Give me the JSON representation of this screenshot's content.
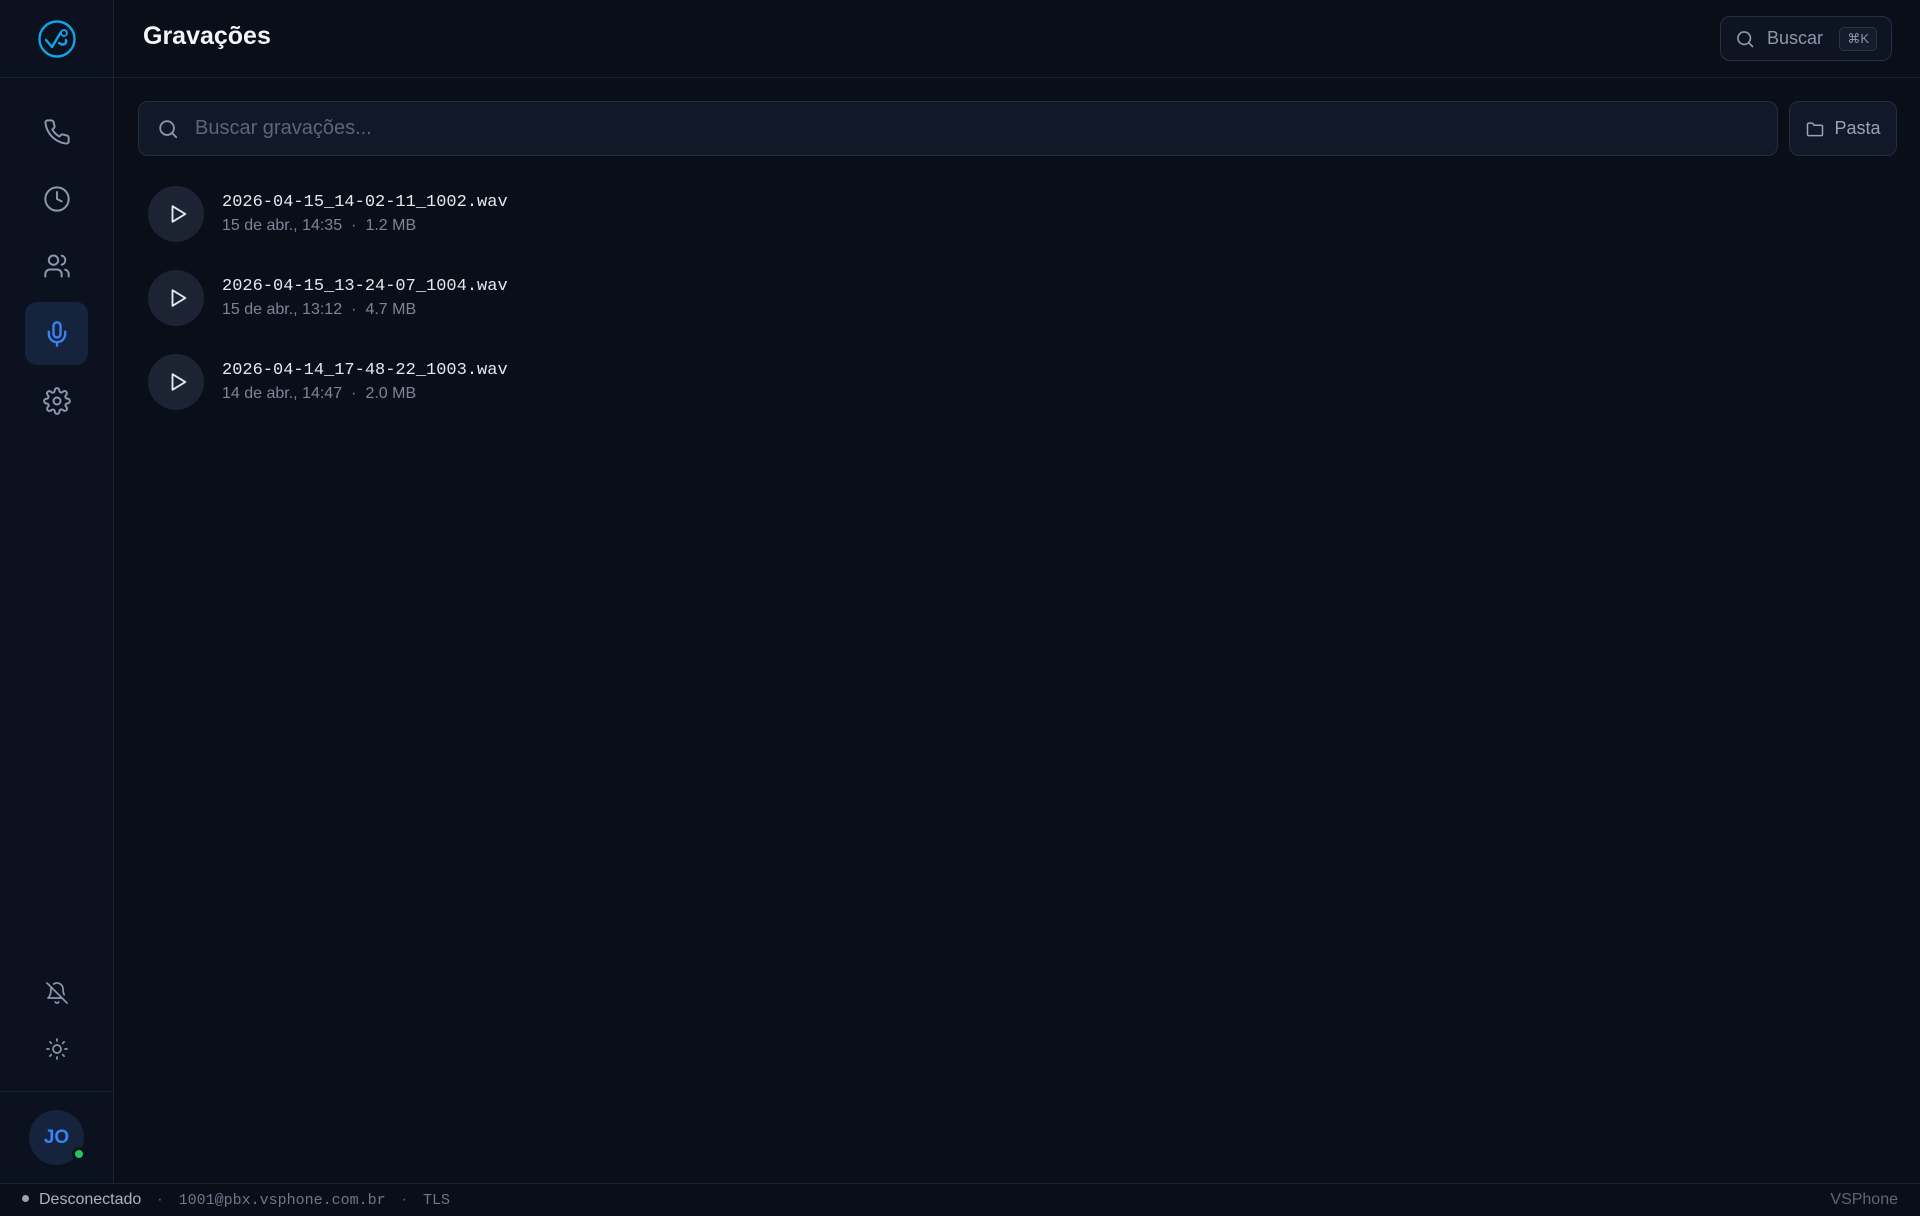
{
  "app": {
    "brand": "VSPhone"
  },
  "header": {
    "title": "Gravações",
    "search_label": "Buscar",
    "search_shortcut": "⌘K"
  },
  "sidebar": {
    "nav": [
      {
        "name": "phone",
        "icon": "phone-icon",
        "active": false
      },
      {
        "name": "history",
        "icon": "clock-icon",
        "active": false
      },
      {
        "name": "contacts",
        "icon": "users-icon",
        "active": false
      },
      {
        "name": "recordings",
        "icon": "microphone-icon",
        "active": true
      },
      {
        "name": "settings",
        "icon": "gear-icon",
        "active": false
      }
    ],
    "utilities": [
      {
        "name": "notifications",
        "icon": "bell-off-icon"
      },
      {
        "name": "theme",
        "icon": "sun-icon"
      }
    ],
    "user": {
      "initials": "JO",
      "presence": "online"
    }
  },
  "main": {
    "search_placeholder": "Buscar gravações...",
    "folder_label": "Pasta",
    "recordings": [
      {
        "filename": "2026-04-15_14-02-11_1002.wav",
        "date": "15 de abr., 14:35",
        "size": "1.2 MB"
      },
      {
        "filename": "2026-04-15_13-24-07_1004.wav",
        "date": "15 de abr., 13:12",
        "size": "4.7 MB"
      },
      {
        "filename": "2026-04-14_17-48-22_1003.wav",
        "date": "14 de abr., 14:47",
        "size": "2.0 MB"
      }
    ]
  },
  "statusbar": {
    "connection": "Desconectado",
    "account": "1001@pbx.vsphone.com.br",
    "transport": "TLS"
  },
  "colors": {
    "accent": "#3b82f6",
    "logo": "#0ea5e9",
    "background": "#0a0e19",
    "presence_online": "#22c55e"
  }
}
